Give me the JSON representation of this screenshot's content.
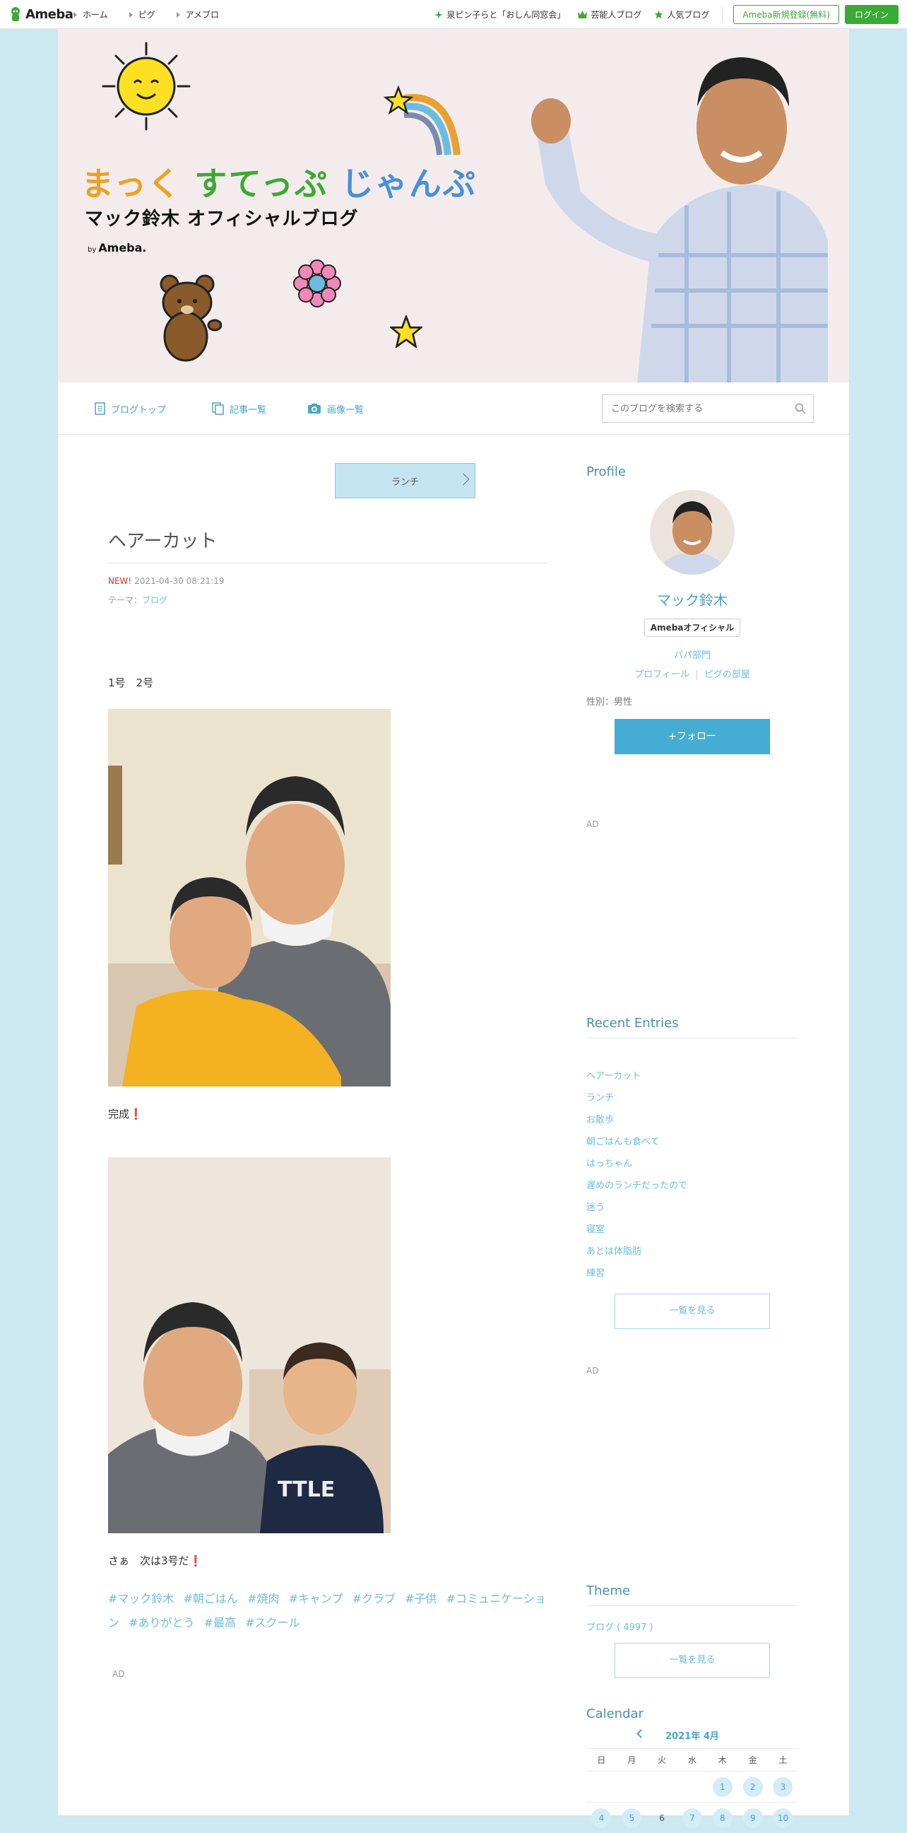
{
  "topbar": {
    "logo": "Ameba",
    "nav": [
      "ホーム",
      "ピグ",
      "アメブロ"
    ],
    "right_links": [
      "泉ピン子らと「おしん同窓会」",
      "芸能人ブログ",
      "人気ブログ"
    ],
    "register_label": "Ameba新規登録(無料)",
    "login_label": "ログイン"
  },
  "banner": {
    "title_1": "まっく",
    "title_2": "すてっぷ",
    "title_3": "じゃんぷ",
    "subtitle": "マック鈴木 オフィシャルブログ",
    "by": "by",
    "by_brand": "Ameba."
  },
  "blognav": {
    "items": [
      "ブログトップ",
      "記事一覧",
      "画像一覧"
    ],
    "search_placeholder": "このブログを検索する"
  },
  "entry": {
    "category_button": "ランチ",
    "title": "ヘアーカット",
    "new_label": "NEW!",
    "datetime": "2021-04-30 08:21:19",
    "theme_prefix": "テーマ：",
    "theme": "ブログ",
    "text_1": "1号　2号",
    "text_2": "完成",
    "text_3": "さぁ　次は3号だ",
    "exclaim": "❗",
    "hashtags": [
      "#マック鈴木",
      "#朝ごはん",
      "#焼肉",
      "#キャンプ",
      "#クラブ",
      "#子供",
      "#コミュニケーション",
      "#ありがとう",
      "#最高",
      "#スクール"
    ],
    "ad_label": "AD"
  },
  "sidebar": {
    "profile_heading": "Profile",
    "name": "マック鈴木",
    "badge": "Amebaオフィシャル",
    "category": "パパ部門",
    "link_profile": "プロフィール",
    "link_pig": "ピグの部屋",
    "gender": "性別：男性",
    "follow_label": "+フォロー",
    "ad_label": "AD",
    "recent_heading": "Recent Entries",
    "recent_entries": [
      "ヘアーカット",
      "ランチ",
      "お散歩",
      "朝ごはんも食べて",
      "はっちゃん",
      "遅めのランチだったので",
      "迷う",
      "寝室",
      "あとは体脂肪",
      "練習"
    ],
    "more_label": "一覧を見る",
    "theme_heading": "Theme",
    "theme_item": "ブログ ( 4997 )",
    "calendar_heading": "Calendar",
    "calendar_month": "2021年 4月",
    "weekdays": [
      "日",
      "月",
      "火",
      "水",
      "木",
      "金",
      "土"
    ],
    "calendar_rows": [
      [
        "",
        "",
        "",
        "",
        "1",
        "2",
        "3"
      ],
      [
        "4",
        "5",
        "6",
        "7",
        "8",
        "9",
        "10"
      ]
    ]
  },
  "colors": {
    "ameba_green": "#3aaa35",
    "link_blue": "#6bbde0",
    "background": "#cce8f1"
  }
}
